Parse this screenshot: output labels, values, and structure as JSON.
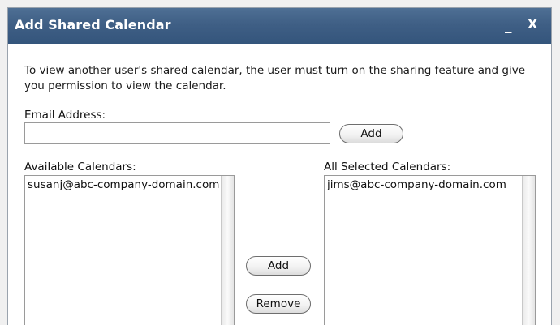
{
  "dialog": {
    "title": "Add Shared Calendar",
    "minimize_glyph": "_",
    "close_glyph": "X",
    "instructions": "To view another user's shared calendar, the user must turn on the sharing feature and give you permission to view the calendar.",
    "email_label": "Email Address:",
    "email_value": "",
    "add_email_button": "Add",
    "available_label": "Available Calendars:",
    "available_items": [
      "susanj@abc-company-domain.com"
    ],
    "selected_label": "All Selected Calendars:",
    "selected_items": [
      "jims@abc-company-domain.com"
    ],
    "add_button": "Add",
    "remove_button": "Remove"
  },
  "colors": {
    "titlebar": "#3f5f85",
    "title_text": "#ffffff",
    "background": "#ffffff"
  }
}
